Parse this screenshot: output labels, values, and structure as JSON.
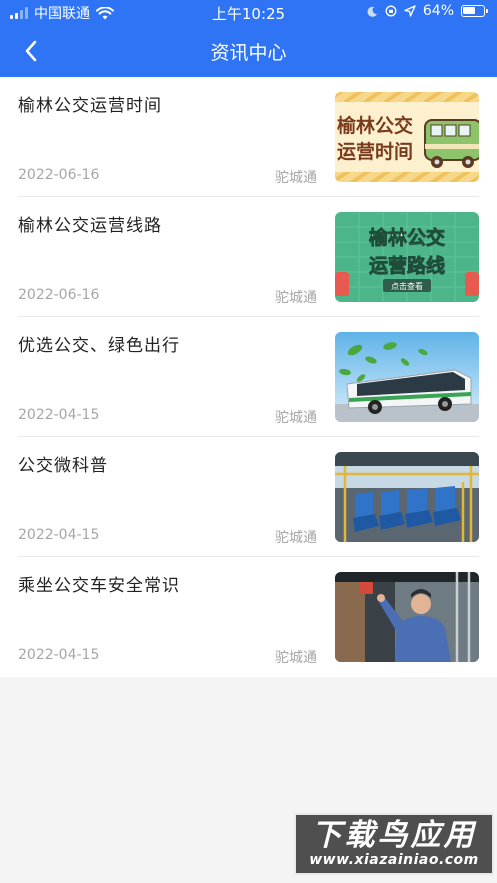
{
  "status_bar": {
    "carrier": "中国联通",
    "time": "上午10:25",
    "battery": "64%",
    "battery_level": 0.64
  },
  "header": {
    "title": "资讯中心",
    "back_icon": "chevron-left-icon"
  },
  "articles": [
    {
      "title": "榆林公交运营时间",
      "date": "2022-06-16",
      "source": "驼城通",
      "thumb_text_1": "榆林公交",
      "thumb_text_2": "运营时间"
    },
    {
      "title": "榆林公交运营线路",
      "date": "2022-06-16",
      "source": "驼城通",
      "thumb_text_1": "榆林公交",
      "thumb_text_2": "运营路线",
      "thumb_text_3": "点击查看"
    },
    {
      "title": "优选公交、绿色出行",
      "date": "2022-04-15",
      "source": "驼城通"
    },
    {
      "title": "公交微科普",
      "date": "2022-04-15",
      "source": "驼城通"
    },
    {
      "title": "乘坐公交车安全常识",
      "date": "2022-04-15",
      "source": "驼城通"
    }
  ],
  "watermark": {
    "main": "下载鸟应用",
    "url": "www.xiazainiao.com"
  },
  "colors": {
    "header_bg": "#2f74f5",
    "page_bg": "#f4f4f4",
    "meta_text": "#a6a6a6"
  }
}
